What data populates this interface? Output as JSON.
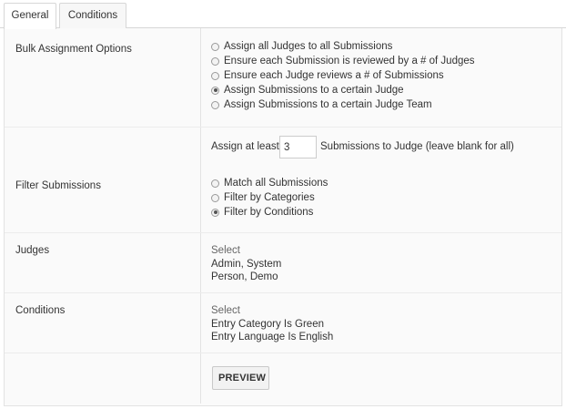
{
  "tabs": [
    {
      "label": "General",
      "active": true
    },
    {
      "label": "Conditions",
      "active": false
    }
  ],
  "bulk": {
    "label": "Bulk Assignment Options",
    "options": [
      {
        "label": "Assign all Judges to all Submissions",
        "selected": false
      },
      {
        "label": "Ensure each Submission is reviewed by a # of Judges",
        "selected": false
      },
      {
        "label": "Ensure each Judge reviews a # of Submissions",
        "selected": false
      },
      {
        "label": "Assign Submissions to a certain Judge",
        "selected": true
      },
      {
        "label": "Assign Submissions to a certain Judge Team",
        "selected": false
      }
    ]
  },
  "assign": {
    "prefix": "Assign at least",
    "value": "3",
    "suffix": "Submissions to Judge (leave blank for all)"
  },
  "filter": {
    "label": "Filter Submissions",
    "options": [
      {
        "label": "Match all Submissions",
        "selected": false
      },
      {
        "label": "Filter by Categories",
        "selected": false
      },
      {
        "label": "Filter by Conditions",
        "selected": true
      }
    ]
  },
  "judges": {
    "label": "Judges",
    "select_label": "Select",
    "items": [
      "Admin, System",
      "Person, Demo"
    ]
  },
  "conditions": {
    "label": "Conditions",
    "select_label": "Select",
    "items": [
      "Entry Category Is Green",
      "Entry Language Is English"
    ]
  },
  "preview_button": "PREVIEW"
}
